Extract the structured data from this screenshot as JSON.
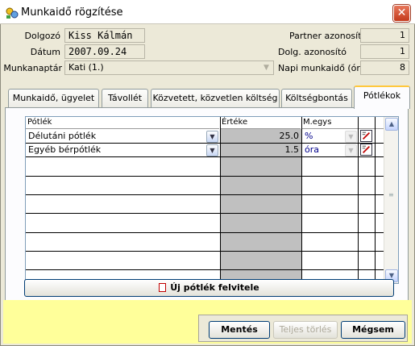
{
  "window": {
    "title": "Munkaidő rögzítése"
  },
  "header": {
    "dolgozo_label": "Dolgozó",
    "dolgozo_value": "Kiss Kálmán",
    "datum_label": "Dátum",
    "datum_value": "2007.09.24",
    "munkanaptar_label": "Munkanaptár",
    "munkanaptar_value": "Kati (1.)",
    "partner_label": "Partner azonosító",
    "partner_value": "1",
    "dolg_label": "Dolg. azonosító",
    "dolg_value": "1",
    "napi_label": "Napi munkaidő (óra)",
    "napi_value": "8"
  },
  "tabs": [
    {
      "label": "Munkaidő, ügyelet"
    },
    {
      "label": "Távollét"
    },
    {
      "label": "Közvetett, közvetlen költség"
    },
    {
      "label": "Költségbontás"
    },
    {
      "label": "Pótlékok",
      "active": true
    }
  ],
  "grid": {
    "columns": [
      "Pótlék",
      "Értéke",
      "M.egys"
    ],
    "rows": [
      {
        "potlek": "Délutáni pótlék",
        "ertek": "25.0",
        "megys": "%"
      },
      {
        "potlek": "Egyéb bérpótlék",
        "ertek": "1.5",
        "megys": "óra"
      }
    ]
  },
  "buttons": {
    "new_label": "Új pótlék felvitele",
    "save_label": "Mentés",
    "delete_label": "Teljes törlés",
    "cancel_label": "Mégsem"
  },
  "colors": {
    "bottom_bar": "#ffff9a",
    "active_tab_accent": "#ffc83c",
    "close_button": "#c43a1c"
  }
}
